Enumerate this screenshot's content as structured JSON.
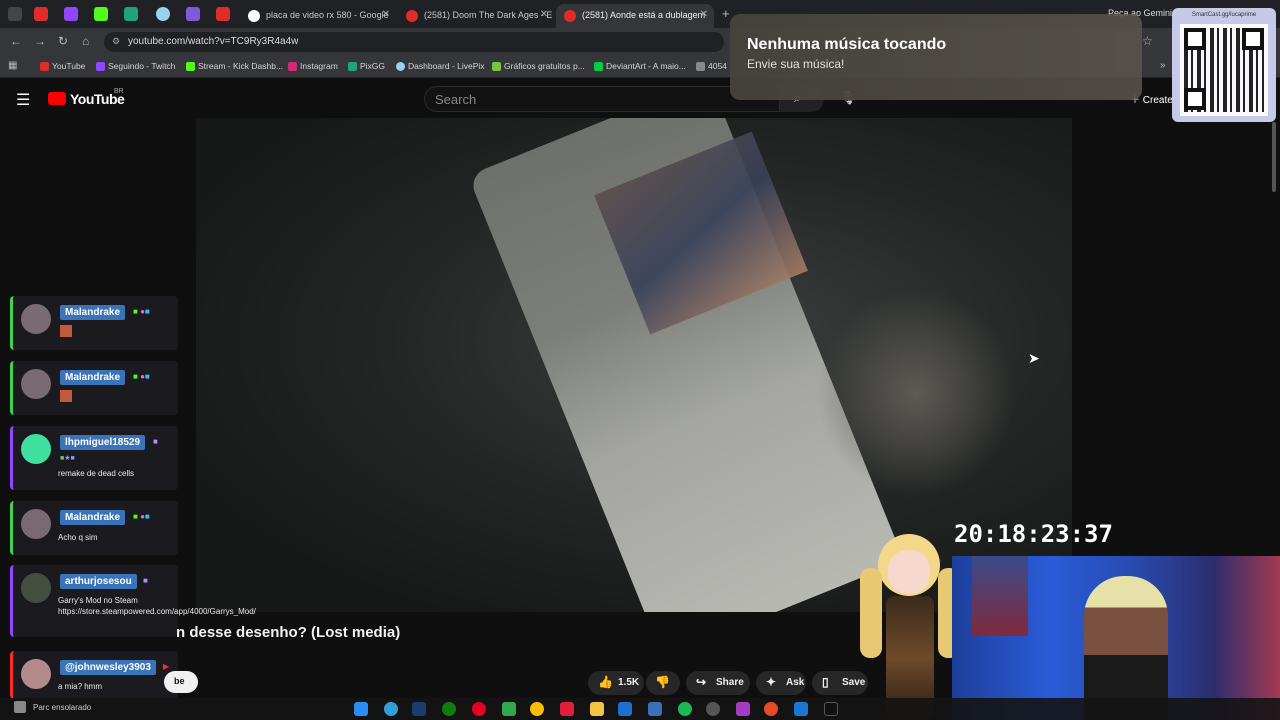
{
  "browser": {
    "tabs": [
      {
        "label": "placa de video rx 580 - Google",
        "active": false
      },
      {
        "label": "(2581) Doom The Dark Ages - E",
        "active": false
      },
      {
        "label": "(2581) Aonde está a dublagem",
        "active": true
      }
    ],
    "gemini_label": "Peça ao Gemini",
    "url": "youtube.com/watch?v=TC9Ry3R4a4w",
    "bookmarks": [
      "YouTube",
      "Seguindo - Twitch",
      "Stream - Kick Dashb...",
      "Instagram",
      "PixGG",
      "Dashboard - LivePix",
      "Gráficos gratuitos p...",
      "DeviantArt - A maio...",
      "4054"
    ]
  },
  "youtube": {
    "logo_text": "YouTube",
    "region": "BR",
    "search_placeholder": "Search",
    "create_label": "Create",
    "video_title_visible": "n desse desenho? (Lost media)",
    "like_count": "1.5K",
    "share_label": "Share",
    "ask_label": "Ask",
    "save_label": "Save",
    "subscribe_fragment": "be"
  },
  "chat": [
    {
      "user": "Malandrake",
      "text": "",
      "accent": "#3fd24c"
    },
    {
      "user": "Malandrake",
      "text": "",
      "accent": "#3fd24c"
    },
    {
      "user": "lhpmiguel18529",
      "text": "remake de dead cells",
      "accent": "#9146ff"
    },
    {
      "user": "Malandrake",
      "text": "Acho q sim",
      "accent": "#3fd24c"
    },
    {
      "user": "arthurjosesou",
      "text": "Garry's Mod no Steam https://store.steampowered.com/app/4000/Garrys_Mod/",
      "accent": "#9146ff"
    },
    {
      "user": "@johnwesley3903",
      "text": "a mia? hmm",
      "accent": "#ff0000"
    }
  ],
  "overlay": {
    "music_title": "Nenhuma música tocando",
    "music_subtitle": "Envie sua música!",
    "qr_label": "SmartCast.gg/lucaprime",
    "clock": "20:18:23:37"
  },
  "taskbar": {
    "weather": "Parc ensolarado"
  }
}
